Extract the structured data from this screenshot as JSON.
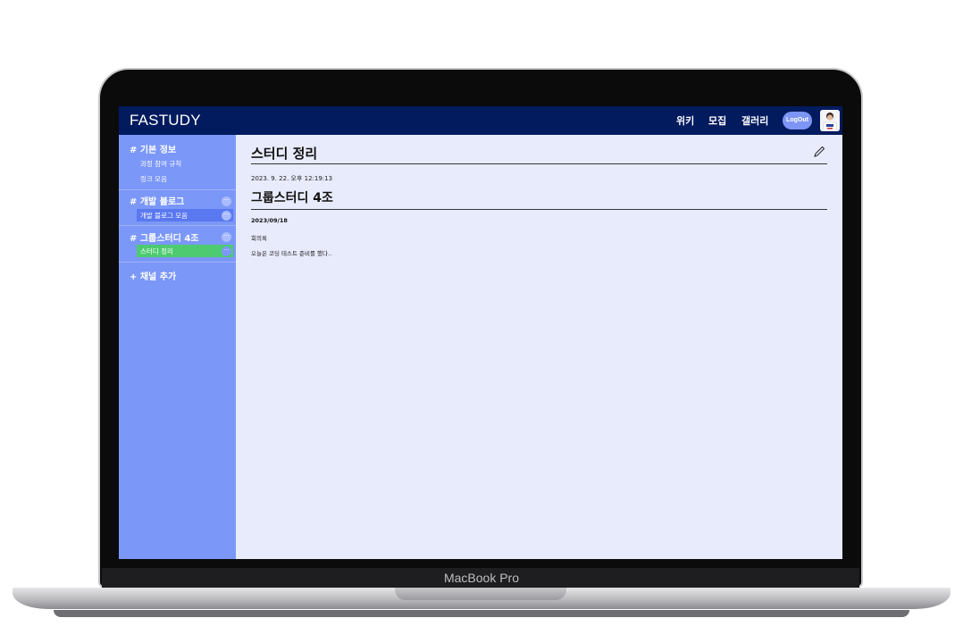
{
  "device": {
    "brand_label": "MacBook Pro"
  },
  "header": {
    "logo": "FASTUDY",
    "nav": [
      "위키",
      "모집",
      "갤러리"
    ],
    "logout_label": "LogOut"
  },
  "sidebar": {
    "sections": [
      {
        "title": "# 기본 정보",
        "items": [
          "과정 참여 규칙",
          "링크 모음"
        ]
      },
      {
        "title": "# 개발 블로그",
        "items": [
          "개발 블로그 모음"
        ]
      },
      {
        "title": "# 그룹스터디 4조",
        "items": [
          "스터디 정리"
        ]
      }
    ],
    "more_glyph": "···",
    "add_channel": "+ 채널 추가"
  },
  "page": {
    "title": "스터디 정리",
    "datetime": "2023. 9. 22. 오후 12:19:13",
    "doc_title": "그룹스터디 4조",
    "doc_date": "2023/09/18",
    "lines": [
      "회의록",
      "오늘은 코딩 테스트 준비를 했다.."
    ]
  },
  "colors": {
    "topbar": "#021a5e",
    "sidebar": "#7b97f8",
    "active_item": "#4ecb71",
    "selected_item": "#5a78f0",
    "content_bg": "#e8ebfc"
  }
}
